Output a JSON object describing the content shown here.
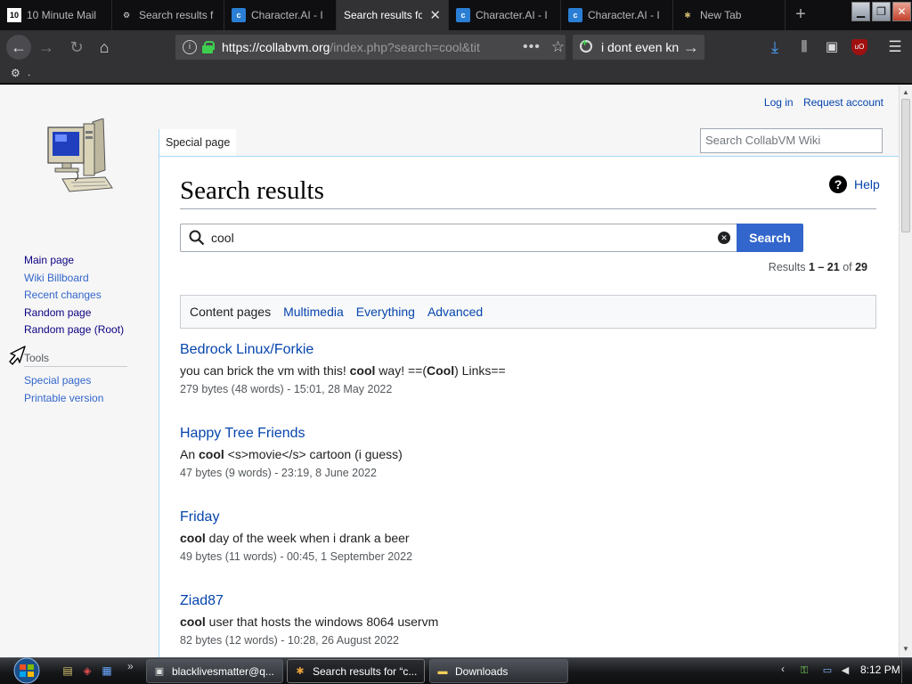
{
  "browser": {
    "tabs": [
      {
        "title": "10 Minute Mail",
        "icon": "10",
        "active": false
      },
      {
        "title": "Search results f",
        "icon": "search",
        "active": false
      },
      {
        "title": "Character.AI - I",
        "icon": "char",
        "active": false
      },
      {
        "title": "Search results fo",
        "icon": "search",
        "active": true
      },
      {
        "title": "Character.AI - I",
        "icon": "char",
        "active": false
      },
      {
        "title": "Character.AI - I",
        "icon": "char",
        "active": false
      },
      {
        "title": "New Tab",
        "icon": "newtab",
        "active": false
      }
    ],
    "url_domain": "https://collabvm.org",
    "url_rest": "/index.php?search=cool&tit",
    "search_text": "i dont even kn",
    "bookmark_label": "."
  },
  "wiki": {
    "personal": {
      "login": "Log in",
      "request": "Request account"
    },
    "nav": [
      {
        "label": "Main page",
        "style": "dark"
      },
      {
        "label": "Wiki Billboard",
        "style": "blue"
      },
      {
        "label": "Recent changes",
        "style": "blue"
      },
      {
        "label": "Random page",
        "style": "dark"
      },
      {
        "label": "Random page (Root)",
        "style": "dark"
      }
    ],
    "tools_heading": "Tools",
    "tools": [
      "Special pages",
      "Printable version"
    ],
    "special_tab": "Special page",
    "search_placeholder": "Search CollabVM Wiki",
    "page_title": "Search results",
    "help": "Help",
    "query": "cool",
    "search_button": "Search",
    "results_prefix": "Results ",
    "results_range": "1 – 21",
    "results_of": " of ",
    "results_total": "29",
    "filters": {
      "current": "Content pages",
      "links": [
        "Multimedia",
        "Everything",
        "Advanced"
      ]
    },
    "results": [
      {
        "title": "Bedrock Linux/Forkie",
        "snippet": [
          {
            "t": "you can brick the vm with this! ",
            "b": false
          },
          {
            "t": "cool",
            "b": true
          },
          {
            "t": " way! ==(",
            "b": false
          },
          {
            "t": "Cool",
            "b": true
          },
          {
            "t": ") Links==",
            "b": false
          }
        ],
        "meta": "279 bytes (48 words) - 15:01, 28 May 2022"
      },
      {
        "title": "Happy Tree Friends",
        "snippet": [
          {
            "t": "An ",
            "b": false
          },
          {
            "t": "cool",
            "b": true
          },
          {
            "t": " <s>movie</s> cartoon (i guess)",
            "b": false
          }
        ],
        "meta": "47 bytes (9 words) - 23:19, 8 June 2022"
      },
      {
        "title": "Friday",
        "snippet": [
          {
            "t": "cool",
            "b": true
          },
          {
            "t": " day of the week when i drank a beer",
            "b": false
          }
        ],
        "meta": "49 bytes (11 words) - 00:45, 1 September 2022"
      },
      {
        "title": "Ziad87",
        "snippet": [
          {
            "t": "cool",
            "b": true
          },
          {
            "t": " user that hosts the windows 8064 uservm",
            "b": false
          }
        ],
        "meta": "82 bytes (12 words) - 10:28, 26 August 2022"
      }
    ]
  },
  "taskbar": {
    "buttons": [
      {
        "label": "blacklivesmatter@q...",
        "icon": "mail",
        "active": false
      },
      {
        "label": "Search results for “c...",
        "icon": "firefox",
        "active": true
      },
      {
        "label": "Downloads",
        "icon": "folder",
        "active": false
      }
    ],
    "clock": "8:12 PM"
  },
  "colors": {
    "link": "#0645ad",
    "accent": "#3366cc",
    "dark_link": "#0b0080",
    "browser_chrome": "#323234"
  }
}
